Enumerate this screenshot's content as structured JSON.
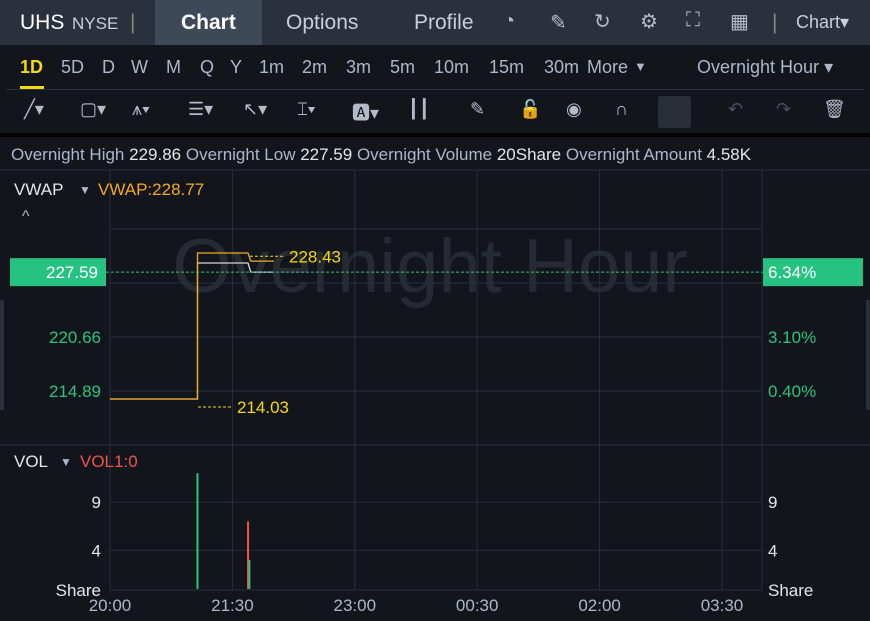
{
  "header": {
    "symbol": "UHS",
    "exchange": "NYSE",
    "tabs": [
      "Chart",
      "Options",
      "Profile"
    ],
    "active_tab": "Chart",
    "chart_menu": "Chart▾",
    "icons": [
      "gauge-icon",
      "edit-icon",
      "refresh-icon",
      "gear-icon",
      "fullscreen-icon",
      "grid-icon"
    ]
  },
  "periods": [
    "1D",
    "5D",
    "D",
    "W",
    "M",
    "Q",
    "Y",
    "1m",
    "2m",
    "3m",
    "5m",
    "10m",
    "15m",
    "30m",
    "More"
  ],
  "active_period": "1D",
  "session": "Overnight Hour",
  "tools": [
    "line-tool-icon",
    "rectangle-tool-icon",
    "pattern-tool-icon",
    "fib-tool-icon",
    "arrow-tool-icon",
    "measure-tool-icon",
    "text-tool-icon",
    "candle-icon",
    "pencil-icon",
    "unlock-icon",
    "eye-icon",
    "magnet-icon",
    "link-icon",
    "undo-icon",
    "redo-icon",
    "trash-icon"
  ],
  "info": {
    "high_label": "Overnight High",
    "high": "229.86",
    "low_label": "Overnight Low",
    "low": "227.59",
    "volume_label": "Overnight Volume",
    "volume": "20Share",
    "amount_label": "Overnight Amount",
    "amount": "4.58K"
  },
  "indicator": {
    "name": "VWAP",
    "value": "VWAP:228.77",
    "collapse": "^"
  },
  "vol_indicator": {
    "name": "VOL",
    "value": "VOL1:0"
  },
  "watermark": "Overnight Hour",
  "colors": {
    "up": "#2ec27e",
    "down": "#f0524f",
    "vwap": "#f5a623",
    "price": "#d6d6d6",
    "marker": "#f5d90a",
    "accent": "#f5d90a"
  },
  "chart_data": {
    "type": "line",
    "x_ticks": [
      "20:00",
      "21:30",
      "23:00",
      "00:30",
      "02:00",
      "03:30"
    ],
    "price_axis": {
      "ticks": [
        "214.89",
        "220.66"
      ],
      "current": "227.59"
    },
    "pct_axis": {
      "ticks": [
        "0.40%",
        "3.10%"
      ],
      "current": "6.34%"
    },
    "series": [
      {
        "name": "VWAP",
        "points": [
          [
            "20:00",
            214.03
          ],
          [
            "21:04",
            214.03
          ],
          [
            "21:04",
            229.64
          ],
          [
            "21:41",
            229.64
          ],
          [
            "21:43",
            228.77
          ],
          [
            "22:00",
            228.77
          ]
        ]
      },
      {
        "points": [
          [
            "20:00",
            214.03
          ],
          [
            "21:04",
            214.03
          ],
          [
            "21:04",
            228.57
          ],
          [
            "21:41",
            228.57
          ],
          [
            "21:43",
            227.59
          ],
          [
            "22:00",
            227.59
          ]
        ]
      }
    ],
    "markers": [
      {
        "label": "228.43",
        "value": 228.43
      },
      {
        "label": "214.03",
        "value": 214.03
      }
    ],
    "volume": {
      "y_ticks": [
        "9",
        "4"
      ],
      "unit": "Share",
      "bars": [
        {
          "time": "21:04",
          "value": 12,
          "dir": "up"
        },
        {
          "time": "21:41",
          "value": 7,
          "dir": "down"
        },
        {
          "time": "21:42",
          "value": 3,
          "dir": "up"
        }
      ]
    }
  }
}
